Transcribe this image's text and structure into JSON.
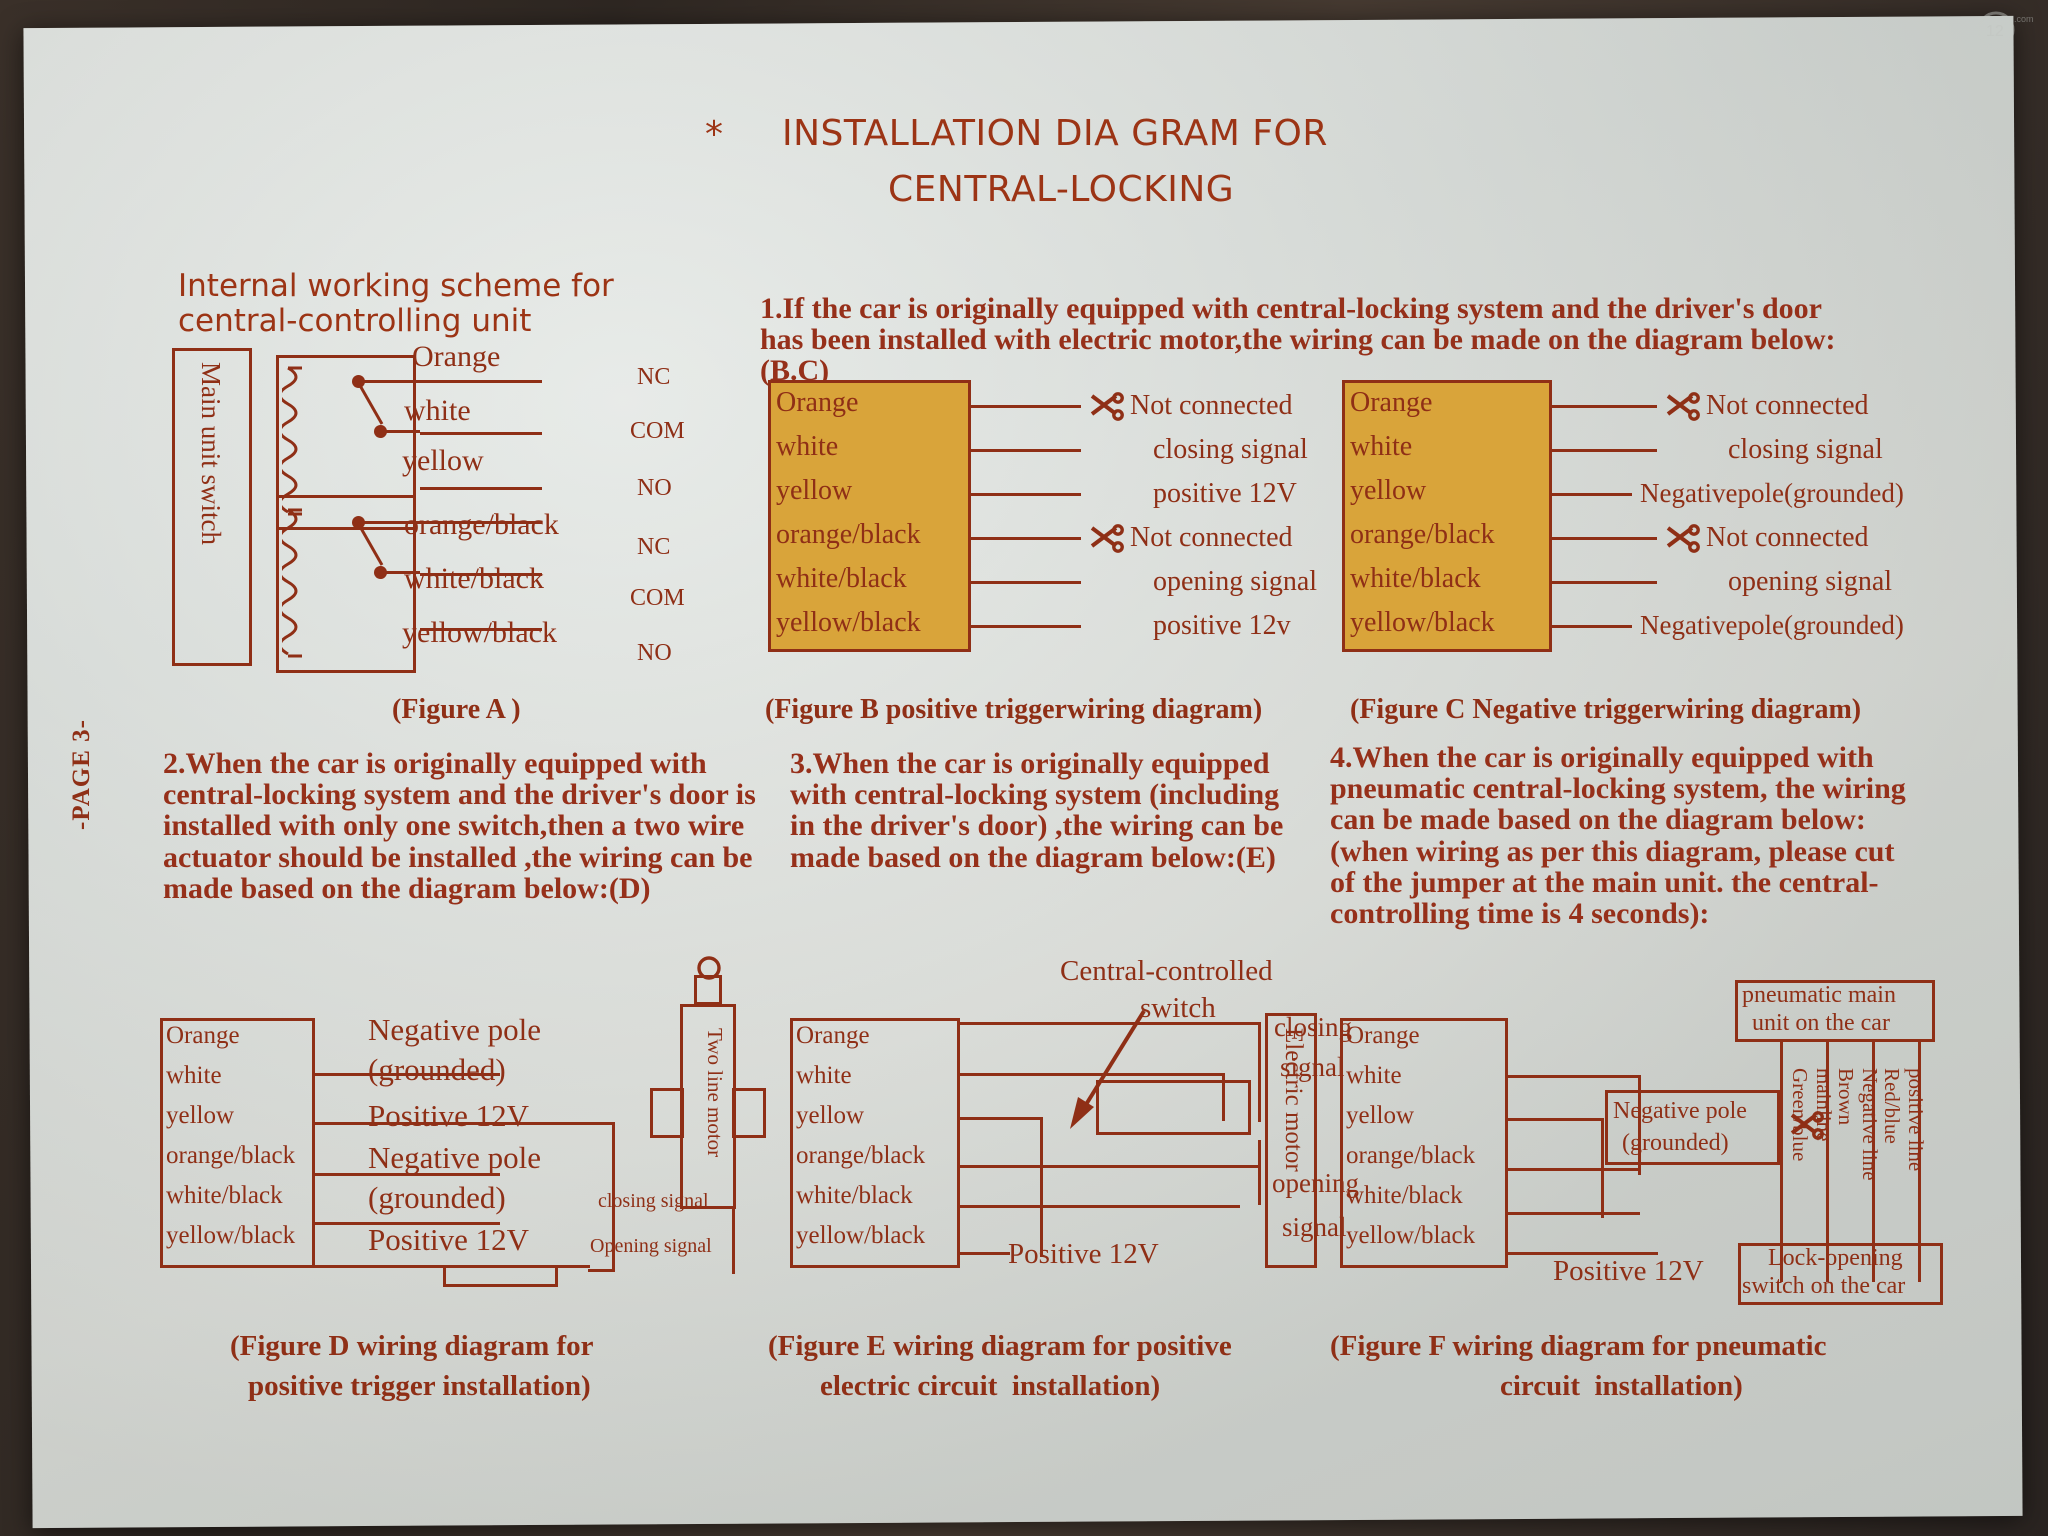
{
  "page": {
    "page_marker": "-PAGE 3-",
    "title_star": "*",
    "title_line1": "INSTALLATION DIA GRAM FOR",
    "title_line2": "CENTRAL-LOCKING",
    "accent_color": "#8f2f16",
    "amber_color": "#d9a43a",
    "paper_color": "#e0e5e1"
  },
  "figure_a": {
    "heading_line1": "Internal working scheme for",
    "heading_line2": "central-controlling unit",
    "unit_label": "Main unit switch",
    "wires": [
      "Orange",
      "white",
      "yellow",
      "orange/black",
      "white/black",
      "yellow/black"
    ],
    "terminals": [
      "NC",
      "COM",
      "NO",
      "NC",
      "COM",
      "NO"
    ],
    "caption": "(Figure A )"
  },
  "section1": {
    "text": "1.If the car is originally equipped with central-locking system and the driver's door has been installed with electric motor,the wiring can be made on the diagram below:(B.C)"
  },
  "figure_b": {
    "wires": [
      "Orange",
      "white",
      "yellow",
      "orange/black",
      "white/black",
      "yellow/black"
    ],
    "assignments": [
      {
        "label": "Not connected",
        "cut": true
      },
      {
        "label": "closing signal",
        "cut": false
      },
      {
        "label": "positive 12V",
        "cut": false
      },
      {
        "label": "Not connected",
        "cut": true
      },
      {
        "label": "opening signal",
        "cut": false
      },
      {
        "label": "positive 12v",
        "cut": false
      }
    ],
    "caption": "(Figure B positive triggerwiring diagram)"
  },
  "figure_c": {
    "wires": [
      "Orange",
      "white",
      "yellow",
      "orange/black",
      "white/black",
      "yellow/black"
    ],
    "assignments": [
      {
        "label": "Not connected",
        "cut": true
      },
      {
        "label": "closing signal",
        "cut": false
      },
      {
        "label": "Negativepole(grounded)",
        "cut": false
      },
      {
        "label": "Not connected",
        "cut": true
      },
      {
        "label": "opening signal",
        "cut": false
      },
      {
        "label": "Negativepole(grounded)",
        "cut": false
      }
    ],
    "caption": "(Figure C Negative triggerwiring diagram)"
  },
  "section2": {
    "text": "2.When the car is originally equipped with central-locking system and the driver's door is installed with only one switch,then a two wire actuator should be installed ,the wiring can be made based on the diagram below:(D)"
  },
  "section3": {
    "text": "3.When the car is originally equipped with central-locking system (including in the driver's door) ,the wiring can be made based on the diagram below:(E)"
  },
  "section4": {
    "text": "4.When the car is originally equipped with pneumatic central-locking system, the wiring can be made based on the diagram below: (when wiring as per this diagram, please cut of the jumper at the main unit. the central-controlling time is 4 seconds):"
  },
  "figure_d": {
    "wires": [
      "Orange",
      "white",
      "yellow",
      "orange/black",
      "white/black",
      "yellow/black"
    ],
    "mid_labels": [
      "Negative pole",
      "(grounded)",
      "Positive 12V",
      "Negative pole",
      "(grounded)",
      "Positive 12V"
    ],
    "motor_label": "Two line motor",
    "closing_label": "closing signal",
    "opening_label": "Opening signal",
    "caption_line1": "(Figure D wiring diagram for",
    "caption_line2": "positive trigger installation)"
  },
  "figure_e": {
    "wires": [
      "Orange",
      "white",
      "yellow",
      "orange/black",
      "white/black",
      "yellow/black"
    ],
    "switch_label_line1": "Central-controlled",
    "switch_label_line2": "switch",
    "closing_label_line1": "closing",
    "closing_label_line2": "signal",
    "opening_label_line1": "opening",
    "opening_label_line2": "signal",
    "motor_label": "Electric motor",
    "positive_label": "Positive 12V",
    "caption_line1": "(Figure E wiring diagram for positive",
    "caption_line2": "electric circuit  installation)"
  },
  "figure_f": {
    "wires": [
      "Orange",
      "white",
      "yellow",
      "orange/black",
      "white/black",
      "yellow/black"
    ],
    "negative_pole_line1": "Negative pole",
    "negative_pole_line2": "(grounded)",
    "positive_label": "Positive 12V",
    "pneumatic_box_line1": "pneumatic main",
    "pneumatic_box_line2": "unit on the car",
    "lock_box_line1": "Lock-opening",
    "lock_box_line2": "switch on the car",
    "vertical_lines": [
      {
        "line1": "Green/blue",
        "line2": "mainline"
      },
      {
        "line1": "Brown",
        "line2": "Negative line"
      },
      {
        "line1": "Red/blue",
        "line2": "positive line"
      }
    ],
    "caption_line1": "(Figure F wiring diagram for pneumatic",
    "caption_line2": "circuit  installation)"
  }
}
